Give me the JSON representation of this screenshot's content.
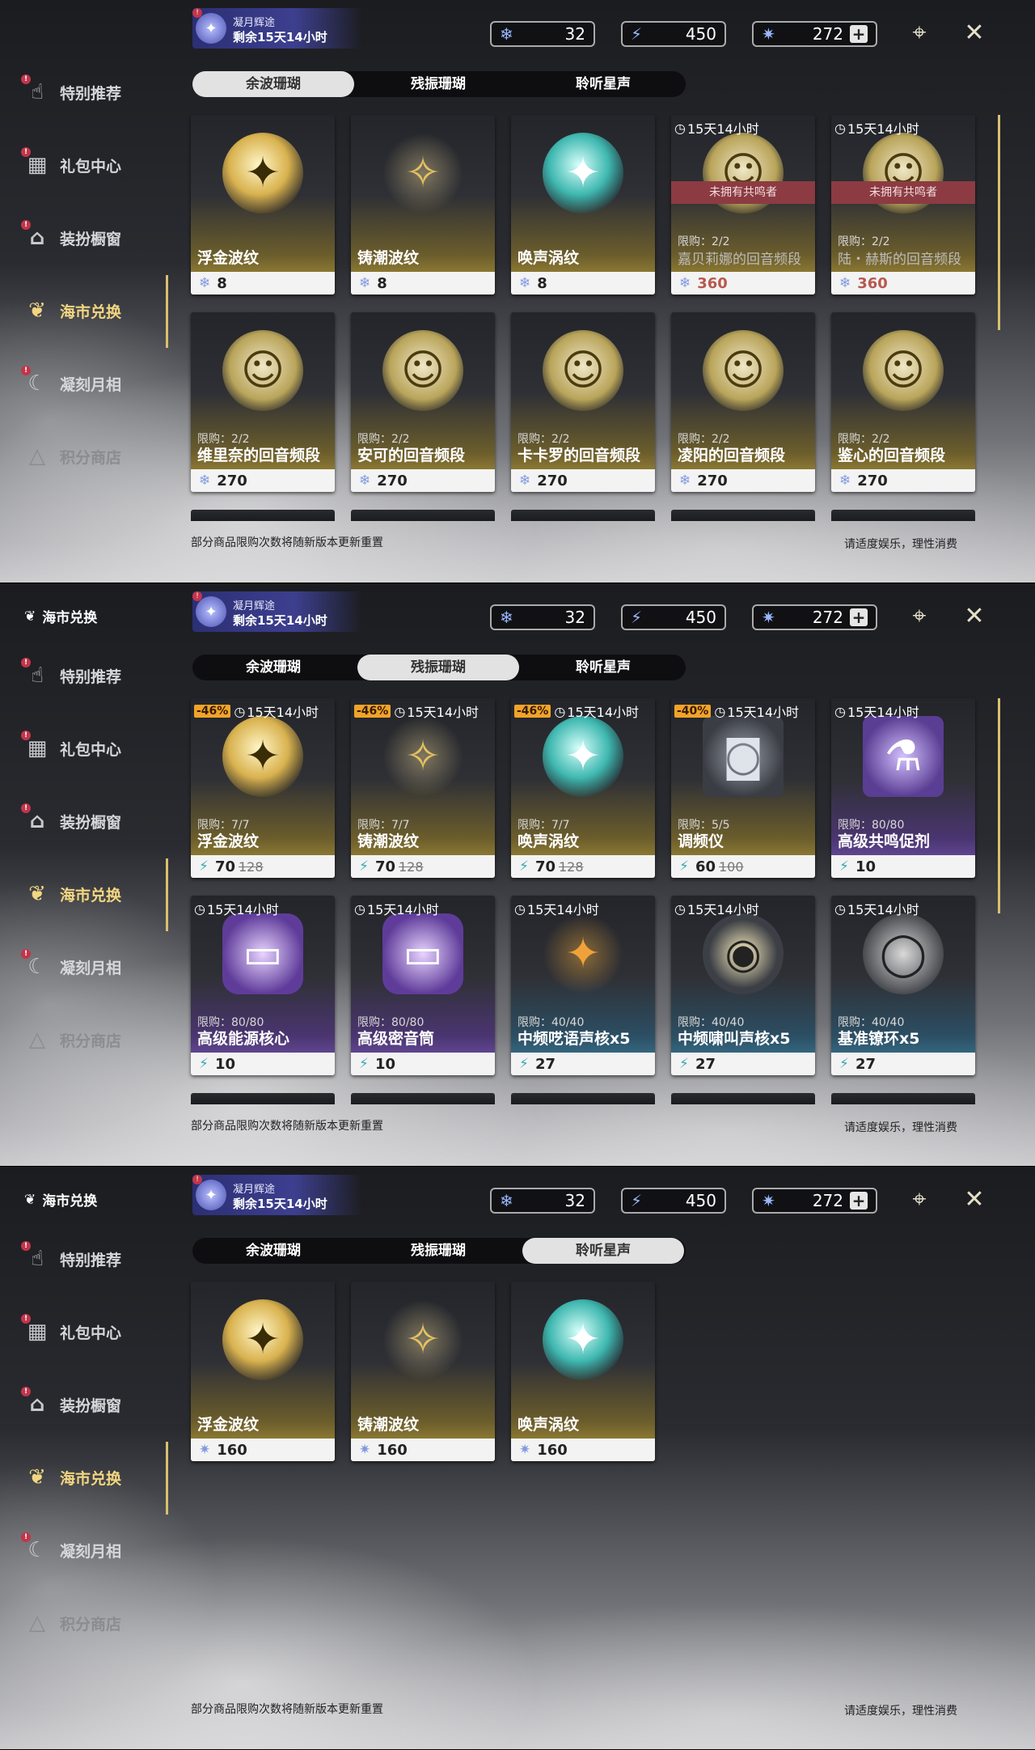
{
  "sidebar": {
    "items": [
      {
        "label": "特别推荐",
        "icon": "hand-gift-icon"
      },
      {
        "label": "礼包中心",
        "icon": "gift-box-icon"
      },
      {
        "label": "装扮橱窗",
        "icon": "wardrobe-icon"
      },
      {
        "label": "海市兑换",
        "icon": "coral-icon"
      },
      {
        "label": "凝刻月相",
        "icon": "moon-phase-icon"
      },
      {
        "label": "积分商店",
        "icon": "points-triangle-icon"
      }
    ],
    "brand_label": "海市兑换"
  },
  "event": {
    "title": "凝月辉途",
    "remaining": "剩余15天14小时"
  },
  "currencies": [
    {
      "value": "32",
      "icon": "afterglow-coral-icon"
    },
    {
      "value": "450",
      "icon": "oscillated-coral-icon"
    },
    {
      "value": "272",
      "icon": "lustrous-tide-icon"
    }
  ],
  "tabs": [
    "余波珊瑚",
    "残振珊瑚",
    "聆听星声"
  ],
  "panels": [
    {
      "active_tab": 0,
      "show_brand": false,
      "cards": [
        {
          "name": "浮金波纹",
          "price": "8",
          "img": "gold",
          "glyph": "✦"
        },
        {
          "name": "铸潮波纹",
          "price": "8",
          "img": "star",
          "glyph": "✧"
        },
        {
          "name": "唤声涡纹",
          "price": "8",
          "img": "teal",
          "glyph": "✦"
        },
        {
          "name": "嘉贝莉娜的回音频段",
          "price": "360",
          "timer": "15天14小时",
          "limit": "限购：2/2",
          "unowned": "未拥有共鸣者",
          "img": "char",
          "glyph": "☺",
          "faded": true,
          "red": true
        },
        {
          "name": "陆・赫斯的回音频段",
          "price": "360",
          "timer": "15天14小时",
          "limit": "限购：2/2",
          "unowned": "未拥有共鸣者",
          "img": "char",
          "glyph": "☺",
          "faded": true,
          "red": true
        },
        {
          "name": "维里奈的回音频段",
          "price": "270",
          "limit": "限购：2/2",
          "img": "char",
          "glyph": "☺"
        },
        {
          "name": "安可的回音频段",
          "price": "270",
          "limit": "限购：2/2",
          "img": "char",
          "glyph": "☺"
        },
        {
          "name": "卡卡罗的回音频段",
          "price": "270",
          "limit": "限购：2/2",
          "img": "char",
          "glyph": "☺"
        },
        {
          "name": "凌阳的回音频段",
          "price": "270",
          "limit": "限购：2/2",
          "img": "char",
          "glyph": "☺"
        },
        {
          "name": "鉴心的回音频段",
          "price": "270",
          "limit": "限购：2/2",
          "img": "char",
          "glyph": "☺"
        }
      ],
      "peek": true
    },
    {
      "active_tab": 1,
      "show_brand": true,
      "cards": [
        {
          "name": "浮金波纹",
          "price": "70",
          "old": "128",
          "discount": "-46%",
          "timer": "15天14小时",
          "limit": "限购：7/7",
          "img": "gold",
          "glyph": "✦",
          "teal": true
        },
        {
          "name": "铸潮波纹",
          "price": "70",
          "old": "128",
          "discount": "-46%",
          "timer": "15天14小时",
          "limit": "限购：7/7",
          "img": "star",
          "glyph": "✧",
          "teal": true
        },
        {
          "name": "唤声涡纹",
          "price": "70",
          "old": "128",
          "discount": "-46%",
          "timer": "15天14小时",
          "limit": "限购：7/7",
          "img": "teal",
          "glyph": "✦",
          "teal": true
        },
        {
          "name": "调频仪",
          "price": "60",
          "old": "100",
          "discount": "-40%",
          "timer": "15天14小时",
          "limit": "限购：5/5",
          "img": "dev",
          "glyph": "◙",
          "teal": true
        },
        {
          "name": "高级共鸣促剂",
          "price": "10",
          "timer": "15天14小时",
          "limit": "限购：80/80",
          "img": "vial",
          "glyph": "⚗",
          "color": "purple",
          "teal": true
        },
        {
          "name": "高级能源核心",
          "price": "10",
          "timer": "15天14小时",
          "limit": "限购：80/80",
          "img": "core",
          "glyph": "▭",
          "color": "purple",
          "teal": true
        },
        {
          "name": "高级密音筒",
          "price": "10",
          "timer": "15天14小时",
          "limit": "限购：80/80",
          "img": "core",
          "glyph": "▭",
          "color": "purple",
          "teal": true
        },
        {
          "name": "中频呓语声核x5",
          "price": "27",
          "timer": "15天14小时",
          "limit": "限购：40/40",
          "img": "cross",
          "glyph": "✦",
          "color": "blue",
          "teal": true
        },
        {
          "name": "中频啸叫声核x5",
          "price": "27",
          "timer": "15天14小时",
          "limit": "限购：40/40",
          "img": "orb",
          "glyph": "◉",
          "color": "blue",
          "teal": true
        },
        {
          "name": "基准镣环x5",
          "price": "27",
          "timer": "15天14小时",
          "limit": "限购：40/40",
          "img": "ring",
          "glyph": "◯",
          "color": "blue",
          "teal": true
        }
      ],
      "peek": true
    },
    {
      "active_tab": 2,
      "show_brand": true,
      "cards": [
        {
          "name": "浮金波纹",
          "price": "160",
          "img": "gold",
          "glyph": "✦",
          "star": true
        },
        {
          "name": "铸潮波纹",
          "price": "160",
          "img": "star",
          "glyph": "✧",
          "star": true
        },
        {
          "name": "唤声涡纹",
          "price": "160",
          "img": "teal",
          "glyph": "✦",
          "star": true
        }
      ],
      "peek": false
    }
  ],
  "footer": {
    "left": "部分商品限购次数将随新版本更新重置",
    "right": "请适度娱乐，理性消费"
  },
  "colors": {
    "accent": "#d9c070",
    "unowned": "#8c3b42",
    "discount": "#f0a42a"
  }
}
